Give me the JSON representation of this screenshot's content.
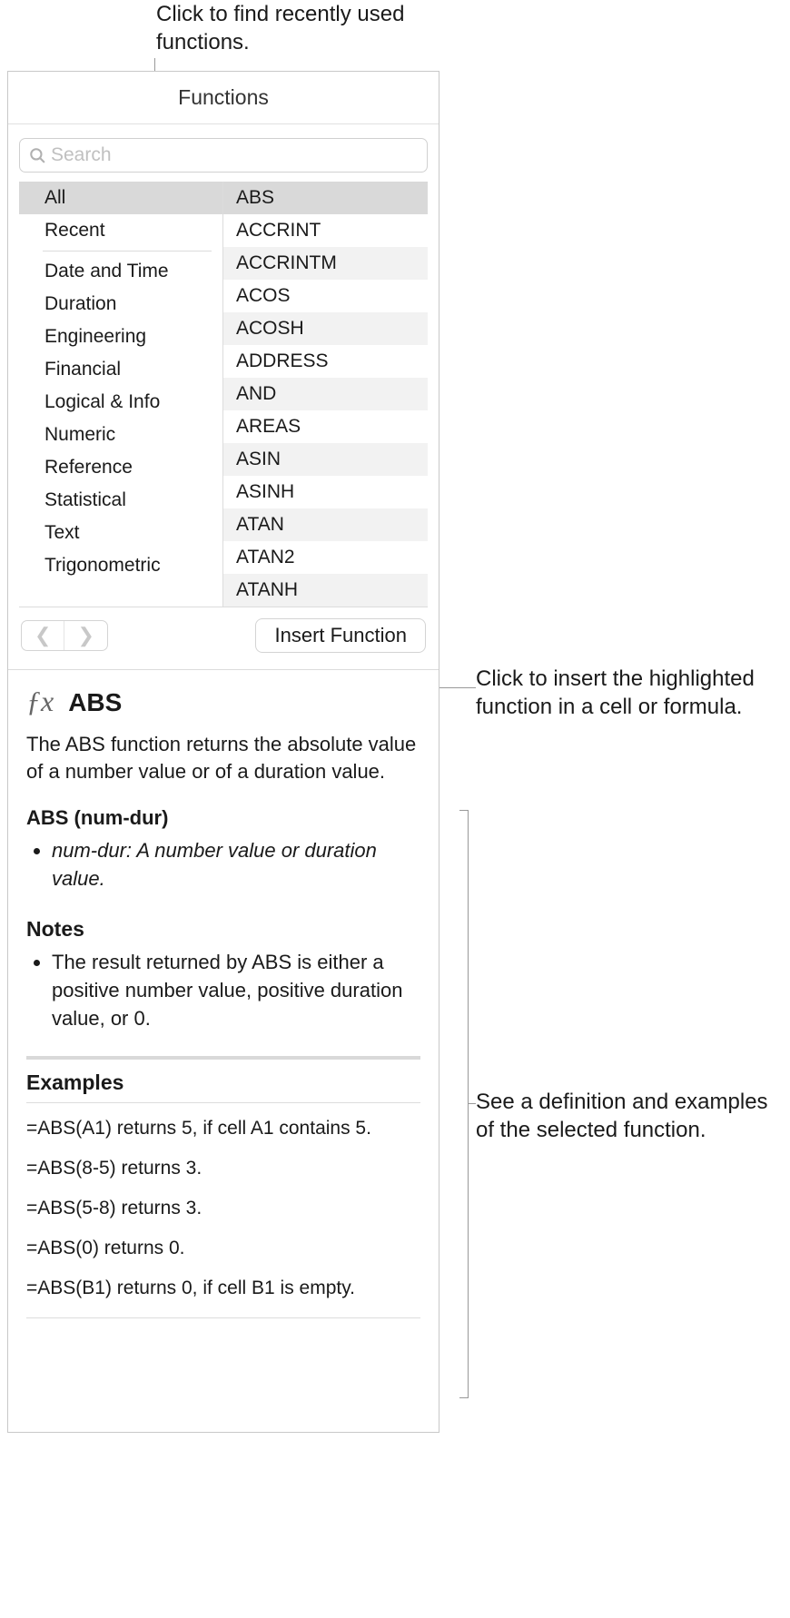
{
  "callouts": {
    "top": "Click to find recently used functions.",
    "insert": "Click to insert the highlighted function in a cell or formula.",
    "help": "See a definition and examples of the selected function."
  },
  "panel": {
    "title": "Functions",
    "search_placeholder": "Search",
    "insert_label": "Insert Function"
  },
  "categories": [
    "All",
    "Recent",
    "Date and Time",
    "Duration",
    "Engineering",
    "Financial",
    "Logical & Info",
    "Numeric",
    "Reference",
    "Statistical",
    "Text",
    "Trigonometric"
  ],
  "functions": [
    "ABS",
    "ACCRINT",
    "ACCRINTM",
    "ACOS",
    "ACOSH",
    "ADDRESS",
    "AND",
    "AREAS",
    "ASIN",
    "ASINH",
    "ATAN",
    "ATAN2",
    "ATANH"
  ],
  "help": {
    "name": "ABS",
    "description": "The ABS function returns the absolute value of a number value or of a duration value.",
    "syntax": "ABS (num-dur)",
    "param": "num-dur: A number value or duration value.",
    "notes_title": "Notes",
    "note": "The result returned by ABS is either a positive number value, positive duration value, or 0.",
    "examples_title": "Examples",
    "examples": [
      "=ABS(A1) returns 5, if cell A1 contains 5.",
      "=ABS(8-5) returns 3.",
      "=ABS(5-8) returns 3.",
      "=ABS(0) returns 0.",
      "=ABS(B1) returns 0, if cell B1 is empty."
    ]
  }
}
